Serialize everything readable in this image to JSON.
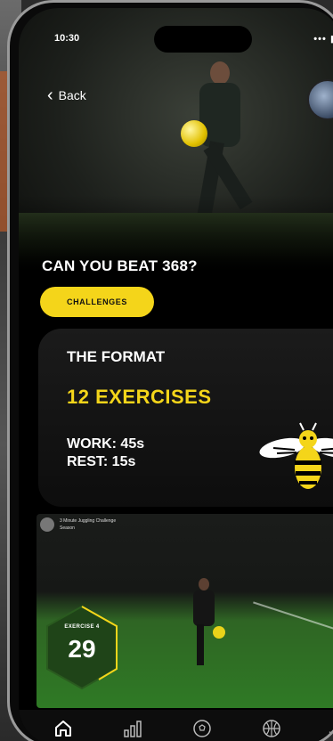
{
  "status": {
    "time": "10:30",
    "icons": "••• ▮▮"
  },
  "nav": {
    "back_label": "Back"
  },
  "hero": {
    "title": "CAN YOU BEAT 368?",
    "chip_label": "CHALLENGES"
  },
  "format": {
    "title": "THE FORMAT",
    "exercises": "12 EXERCISES",
    "work": "WORK: 45s",
    "rest": "REST: 15s"
  },
  "video": {
    "channel": "3 Minute Juggling Challenge",
    "subtitle": "Season",
    "exercise_label": "EXERCISE 4",
    "exercise_value": "29"
  },
  "tabs": [
    {
      "icon": "home-icon"
    },
    {
      "icon": "stats-icon"
    },
    {
      "icon": "football-icon"
    },
    {
      "icon": "basketball-icon"
    },
    {
      "icon": "more-icon"
    }
  ],
  "colors": {
    "accent": "#f4d51a",
    "background": "#000000"
  }
}
